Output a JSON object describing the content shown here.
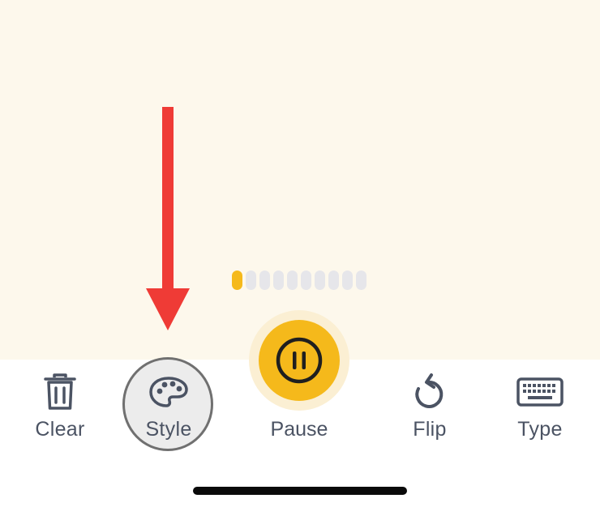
{
  "toolbar": {
    "clear_label": "Clear",
    "style_label": "Style",
    "pause_label": "Pause",
    "flip_label": "Flip",
    "type_label": "Type"
  },
  "progress": {
    "segments_total": 10,
    "segments_filled": 1
  },
  "colors": {
    "canvas_bg": "#FDF8EC",
    "accent": "#F5B91B",
    "icon": "#4B5363",
    "annotation_arrow": "#EF3B36"
  },
  "icons": {
    "clear": "trash-icon",
    "style": "palette-icon",
    "pause": "pause-icon",
    "flip": "rotate-icon",
    "type": "keyboard-icon"
  }
}
